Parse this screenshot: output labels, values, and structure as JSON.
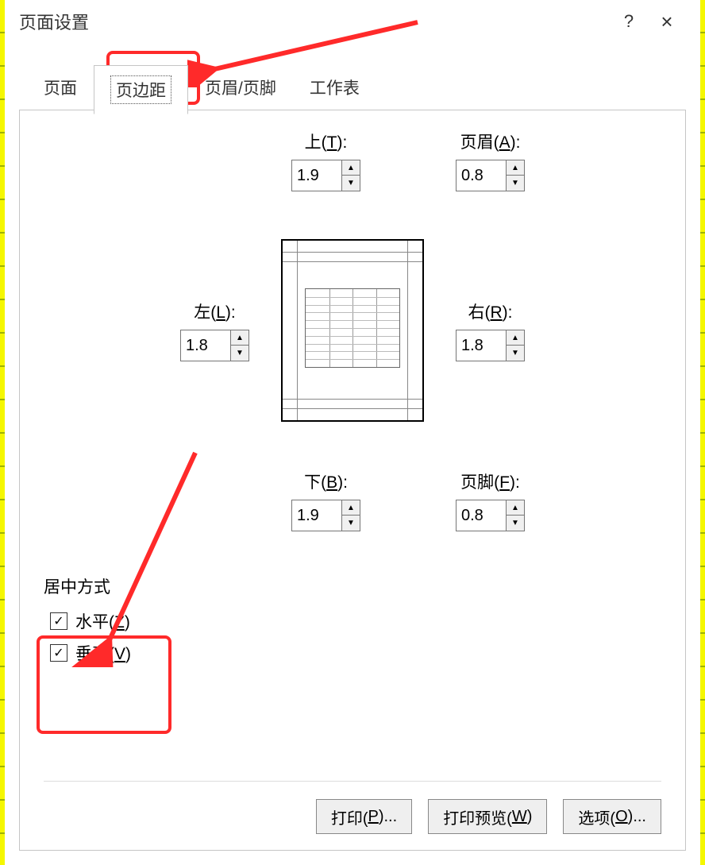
{
  "title": "页面设置",
  "helpSymbol": "?",
  "closeSymbol": "×",
  "tabs": {
    "page": "页面",
    "margins": "页边距",
    "headerFooter": "页眉/页脚",
    "sheet": "工作表"
  },
  "margins": {
    "top": {
      "label_prefix": "上(",
      "hotkey": "T",
      "label_suffix": "):",
      "value": "1.9"
    },
    "header": {
      "label_prefix": "页眉(",
      "hotkey": "A",
      "label_suffix": "):",
      "value": "0.8"
    },
    "left": {
      "label_prefix": "左(",
      "hotkey": "L",
      "label_suffix": "):",
      "value": "1.8"
    },
    "right": {
      "label_prefix": "右(",
      "hotkey": "R",
      "label_suffix": "):",
      "value": "1.8"
    },
    "bottom": {
      "label_prefix": "下(",
      "hotkey": "B",
      "label_suffix": "):",
      "value": "1.9"
    },
    "footer": {
      "label_prefix": "页脚(",
      "hotkey": "F",
      "label_suffix": "):",
      "value": "0.8"
    }
  },
  "centerSection": {
    "title": "居中方式",
    "horizontal": {
      "label_prefix": "水平(",
      "hotkey": "Z",
      "label_suffix": ")",
      "checked": true
    },
    "vertical": {
      "label_prefix": "垂直(",
      "hotkey": "V",
      "label_suffix": ")",
      "checked": true
    }
  },
  "buttons": {
    "print": {
      "prefix": "打印(",
      "hotkey": "P",
      "suffix": ")..."
    },
    "preview": {
      "prefix": "打印预览(",
      "hotkey": "W",
      "suffix": ")"
    },
    "options": {
      "prefix": "选项(",
      "hotkey": "O",
      "suffix": ")..."
    }
  },
  "checkmark": "✓",
  "spinUp": "▲",
  "spinDown": "▼"
}
